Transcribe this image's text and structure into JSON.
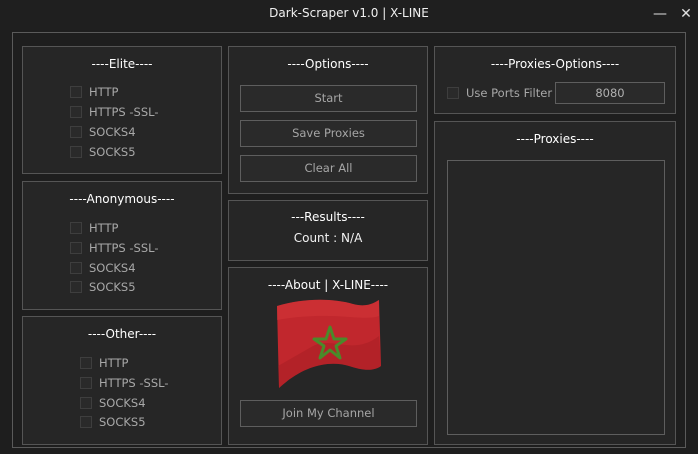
{
  "window": {
    "title": "Dark-Scraper v1.0  | X-LINE",
    "minimize_glyph": "—",
    "close_glyph": "✕"
  },
  "elite": {
    "title": "----Elite----",
    "options": [
      "HTTP",
      "HTTPS -SSL-",
      "SOCKS4",
      "SOCKS5"
    ]
  },
  "anonymous": {
    "title": "----Anonymous----",
    "options": [
      "HTTP",
      "HTTPS -SSL-",
      "SOCKS4",
      "SOCKS5"
    ]
  },
  "other": {
    "title": "----Other----",
    "options": [
      "HTTP",
      "HTTPS -SSL-",
      "SOCKS4",
      "SOCKS5"
    ]
  },
  "options": {
    "title": "----Options----",
    "start_label": "Start",
    "save_label": "Save Proxies",
    "clear_label": "Clear All"
  },
  "results": {
    "title": "---Results----",
    "count_label": "Count :",
    "count_value": "N/A"
  },
  "about": {
    "title": "----About | X-LINE----",
    "join_label": "Join My Channel"
  },
  "proxies_options": {
    "title": "----Proxies-Options----",
    "use_ports_label": "Use Ports Filter",
    "port_value": "8080"
  },
  "proxies": {
    "title": "----Proxies----"
  },
  "colors": {
    "flag_red": "#c1272d",
    "flag_star": "#4a8a2a"
  }
}
